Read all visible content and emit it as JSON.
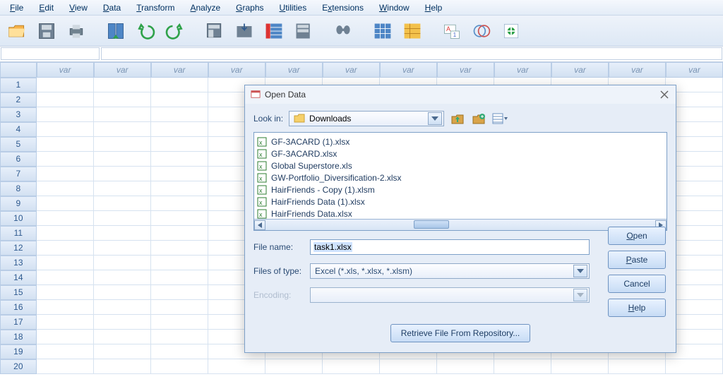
{
  "menu": {
    "file": "File",
    "edit": "Edit",
    "view": "View",
    "data": "Data",
    "transform": "Transform",
    "analyze": "Analyze",
    "graphs": "Graphs",
    "utilities": "Utilities",
    "extensions": "Extensions",
    "window": "Window",
    "help": "Help"
  },
  "grid": {
    "col_label": "var",
    "cols": 12,
    "rows": 20
  },
  "dialog": {
    "title": "Open Data",
    "lookin_label": "Look in:",
    "lookin_value": "Downloads",
    "files": [
      "GF-3ACARD (1).xlsx",
      "GF-3ACARD.xlsx",
      "Global Superstore.xls",
      "GW-Portfolio_Diversification-2.xlsx",
      "HairFriends - Copy (1).xlsm",
      "HairFriends Data (1).xlsx",
      "HairFriends Data.xlsx"
    ],
    "filename_label": "File name:",
    "filename_value": "task1.xlsx",
    "filetype_label": "Files of type:",
    "filetype_value": "Excel (*.xls, *.xlsx, *.xlsm)",
    "encoding_label": "Encoding:",
    "btn_open": "Open",
    "btn_paste": "Paste",
    "btn_cancel": "Cancel",
    "btn_help": "Help",
    "btn_repo": "Retrieve File From Repository..."
  }
}
